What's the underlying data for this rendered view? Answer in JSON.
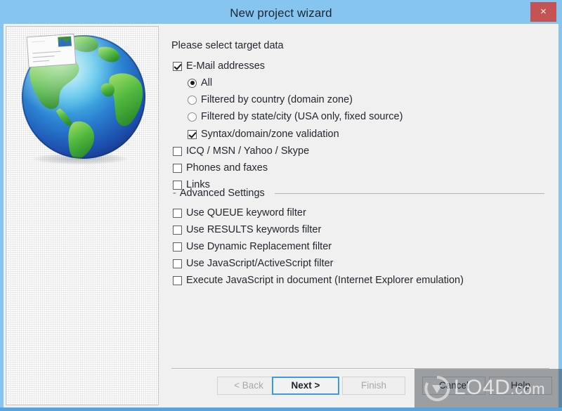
{
  "window": {
    "title": "New project wizard",
    "close_label": "×",
    "accent_color": "#86c5f0",
    "close_color": "#c65353",
    "client_bg": "#f0f0f0"
  },
  "illustration": {
    "globe_icon": "globe-earth-icon",
    "envelope_icon": "envelope-icon"
  },
  "main": {
    "instruction": "Please select target data",
    "target_options": [
      {
        "label": "E-Mail addresses",
        "type": "checkbox",
        "checked": true,
        "indent": 0
      },
      {
        "label": "All",
        "type": "radio",
        "checked": true,
        "indent": 1
      },
      {
        "label": "Filtered by country (domain zone)",
        "type": "radio",
        "checked": false,
        "indent": 1
      },
      {
        "label": "Filtered by state/city (USA only, fixed source)",
        "type": "radio",
        "checked": false,
        "indent": 1
      },
      {
        "label": "Syntax/domain/zone validation",
        "type": "checkbox",
        "checked": true,
        "indent": 1
      },
      {
        "label": "ICQ / MSN / Yahoo / Skype",
        "type": "checkbox",
        "checked": false,
        "indent": 0
      },
      {
        "label": "Phones and faxes",
        "type": "checkbox",
        "checked": false,
        "indent": 0
      },
      {
        "label": "Links",
        "type": "checkbox",
        "checked": false,
        "indent": 0
      }
    ],
    "advanced": {
      "collapse_glyph": "-",
      "title": "Advanced Settings",
      "options": [
        {
          "label": "Use QUEUE keyword filter",
          "type": "checkbox",
          "checked": false
        },
        {
          "label": "Use RESULTS keywords filter",
          "type": "checkbox",
          "checked": false
        },
        {
          "label": "Use Dynamic Replacement filter",
          "type": "checkbox",
          "checked": false
        },
        {
          "label": "Use JavaScript/ActiveScript filter",
          "type": "checkbox",
          "checked": false
        },
        {
          "label": "Execute JavaScript in document (Internet Explorer emulation)",
          "type": "checkbox",
          "checked": false
        }
      ]
    }
  },
  "footer": {
    "buttons": [
      {
        "id": "back",
        "label": "< Back",
        "state": "disabled"
      },
      {
        "id": "next",
        "label": "Next >",
        "state": "default"
      },
      {
        "id": "finish",
        "label": "Finish",
        "state": "disabled"
      },
      {
        "id": "cancel",
        "label": "Cancel",
        "state": "normal"
      },
      {
        "id": "help",
        "label": "Help",
        "state": "normal"
      }
    ]
  },
  "watermark": {
    "text": "LO4D",
    "suffix": ".com",
    "logo_icon": "download-arrow-circle-icon"
  }
}
